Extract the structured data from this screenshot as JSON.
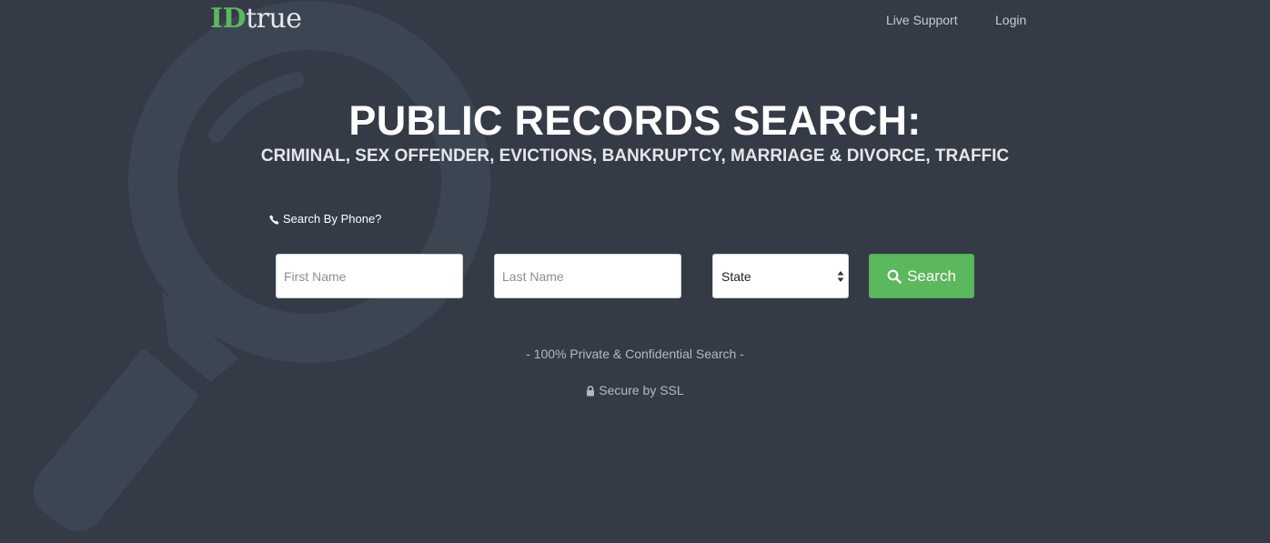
{
  "brand": {
    "logo_accent": "ID",
    "logo_rest": "true",
    "accent_color": "#5cb85c"
  },
  "nav": {
    "live_support": "Live Support",
    "login": "Login"
  },
  "hero": {
    "title": "PUBLIC RECORDS SEARCH:",
    "subtitle": "CRIMINAL, SEX OFFENDER, EVICTIONS, BANKRUPTCY, MARRIAGE & DIVORCE, TRAFFIC"
  },
  "search_form": {
    "phone_toggle_label": "Search By Phone?",
    "first_name_placeholder": "First Name",
    "last_name_placeholder": "Last Name",
    "state_selected": "State",
    "search_button_label": "Search"
  },
  "footer_notes": {
    "private": "- 100% Private & Confidential Search -",
    "ssl": "Secure by SSL"
  },
  "icons": {
    "background": "magnifier-icon",
    "phone": "phone-icon",
    "search": "search-icon",
    "lock": "lock-icon",
    "select_arrows": "select-arrows-icon"
  },
  "colors": {
    "background": "#343b46",
    "magnifier": "#3c4653"
  }
}
